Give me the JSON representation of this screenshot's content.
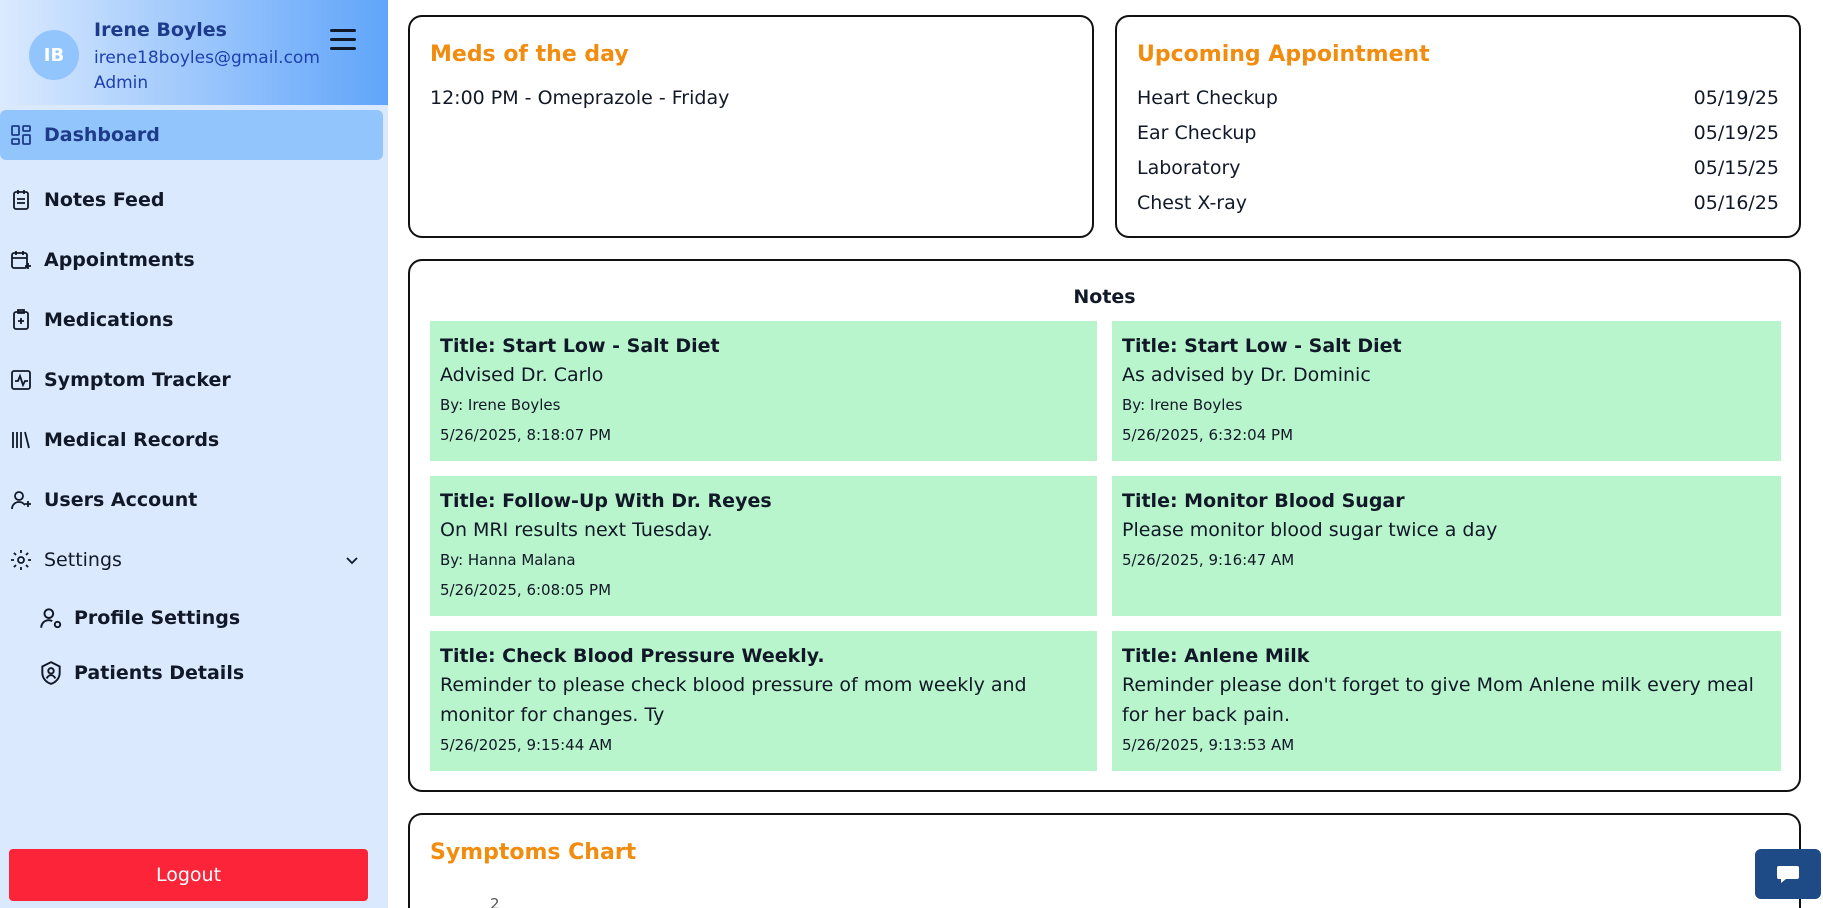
{
  "user": {
    "initials": "IB",
    "name": "Irene Boyles",
    "email": "irene18boyles@gmail.com",
    "role": "Admin"
  },
  "nav": {
    "items": [
      {
        "label": "Dashboard",
        "icon": "dashboard-icon",
        "active": true
      },
      {
        "label": "Notes Feed",
        "icon": "notes-icon"
      },
      {
        "label": "Appointments",
        "icon": "calendar-plus-icon"
      },
      {
        "label": "Medications",
        "icon": "medication-icon"
      },
      {
        "label": "Symptom Tracker",
        "icon": "pulse-icon"
      },
      {
        "label": "Medical Records",
        "icon": "library-icon"
      },
      {
        "label": "Users Account",
        "icon": "user-plus-icon"
      }
    ],
    "settings_label": "Settings",
    "sub_items": [
      {
        "label": "Profile Settings",
        "icon": "user-cog-icon"
      },
      {
        "label": "Patients Details",
        "icon": "shield-user-icon"
      }
    ],
    "logout_label": "Logout"
  },
  "meds": {
    "title": "Meds of the day",
    "entries": [
      "12:00 PM - Omeprazole - Friday"
    ]
  },
  "appointments": {
    "title": "Upcoming Appointment",
    "rows": [
      {
        "name": "Heart Checkup",
        "date": "05/19/25"
      },
      {
        "name": "Ear Checkup",
        "date": "05/19/25"
      },
      {
        "name": "Laboratory",
        "date": "05/15/25"
      },
      {
        "name": "Chest X-ray",
        "date": "05/16/25"
      }
    ]
  },
  "notes": {
    "title": "Notes",
    "items": [
      {
        "title": "Title: Start Low - Salt Diet",
        "body": "Advised Dr. Carlo",
        "by": "By: Irene Boyles",
        "date": "5/26/2025, 8:18:07 PM"
      },
      {
        "title": "Title: Start Low - Salt Diet",
        "body": "As advised by Dr. Dominic",
        "by": "By: Irene Boyles",
        "date": "5/26/2025, 6:32:04 PM"
      },
      {
        "title": "Title: Follow-Up With Dr. Reyes",
        "body": "On MRI results next Tuesday.",
        "by": "By: Hanna Malana",
        "date": "5/26/2025, 6:08:05 PM"
      },
      {
        "title": "Title: Monitor Blood Sugar",
        "body": "Please monitor blood sugar twice a day",
        "by": "",
        "date": "5/26/2025, 9:16:47 AM"
      },
      {
        "title": "Title: Check Blood Pressure Weekly.",
        "body": "Reminder to please check blood pressure of mom weekly and monitor for changes. Ty",
        "by": "",
        "date": "5/26/2025, 9:15:44 AM"
      },
      {
        "title": "Title: Anlene Milk",
        "body": "Reminder please don't forget to give Mom Anlene milk every meal for her back pain.",
        "by": "",
        "date": "5/26/2025, 9:13:53 AM"
      }
    ]
  },
  "symptoms": {
    "title": "Symptoms Chart",
    "y_tick_top": "2"
  },
  "chat": {
    "icon": "chat-icon"
  },
  "colors": {
    "accent_orange": "#f28c0f",
    "note_green": "#b9f5cc",
    "logout_red": "#fb2438",
    "sidebar_bg": "#dbe9ff",
    "chart_bar": "#7fcf9c"
  }
}
